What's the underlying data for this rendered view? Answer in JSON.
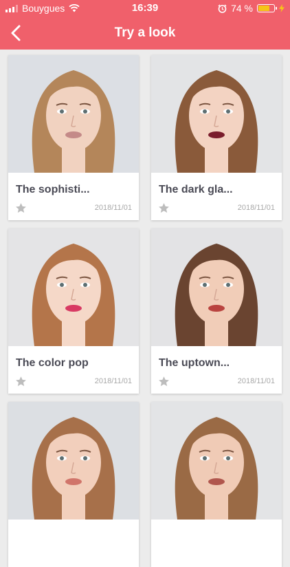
{
  "status_bar": {
    "carrier": "Bouygues",
    "time": "16:39",
    "battery_percent": "74 %",
    "battery_level": 0.74
  },
  "navbar": {
    "title": "Try a look",
    "back_icon": "chevron-left-icon"
  },
  "colors": {
    "header": "#f0606b",
    "card_title": "#4a4a55",
    "date": "#a8a8a8",
    "star": "#bdbdbd"
  },
  "looks": [
    {
      "name": "The sophisti...",
      "date": "2018/11/01",
      "hair": "#b4865a",
      "skin": "#f1d2c0",
      "lips": "#c48a88",
      "bg": "#dcdfe4"
    },
    {
      "name": "The dark gla...",
      "date": "2018/11/01",
      "hair": "#8a5a3a",
      "skin": "#f3d3c2",
      "lips": "#7a1d2c",
      "bg": "#e3e4e6"
    },
    {
      "name": "The color pop",
      "date": "2018/11/01",
      "hair": "#b4754a",
      "skin": "#f5d8c8",
      "lips": "#d83a63",
      "bg": "#e4e4e6"
    },
    {
      "name": "The uptown...",
      "date": "2018/11/01",
      "hair": "#6a4430",
      "skin": "#f1cdb8",
      "lips": "#b9433f",
      "bg": "#e3e3e5"
    },
    {
      "name": "",
      "date": "",
      "hair": "#a7704a",
      "skin": "#f2cfbc",
      "lips": "#d0746a",
      "bg": "#dcdfe3"
    },
    {
      "name": "",
      "date": "",
      "hair": "#9a6a45",
      "skin": "#f0cbb6",
      "lips": "#b0564d",
      "bg": "#e3e4e6"
    }
  ]
}
